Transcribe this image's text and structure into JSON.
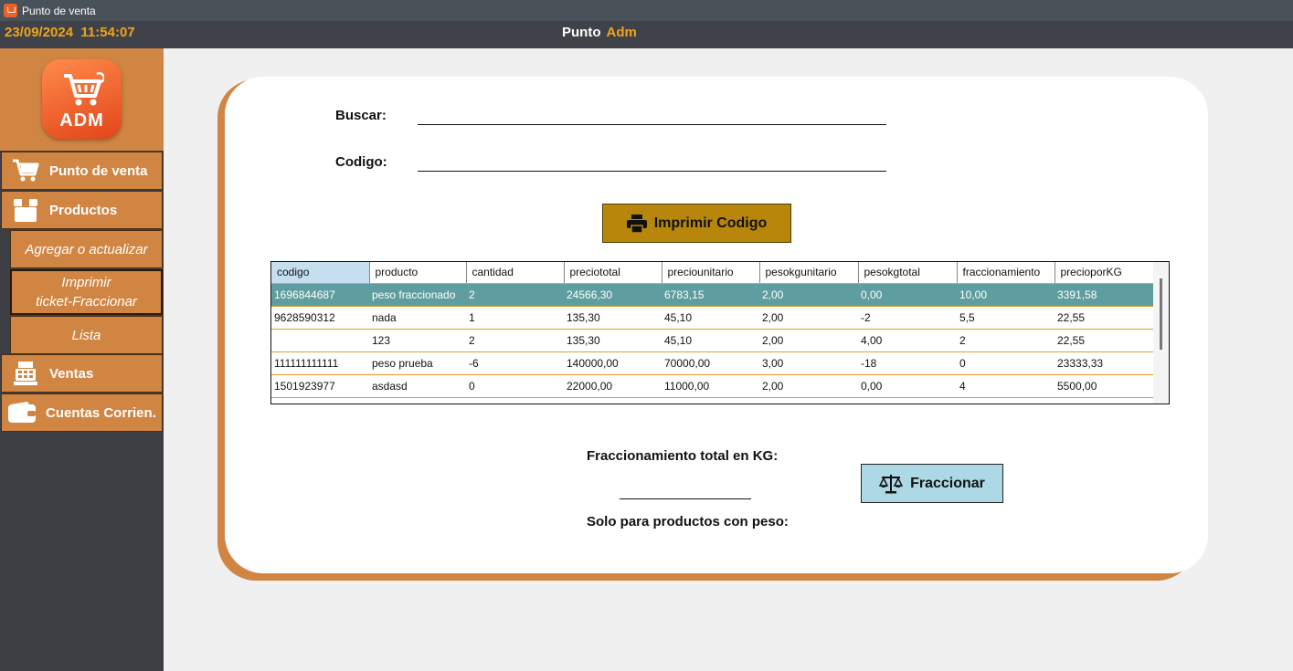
{
  "window": {
    "title": "Punto de venta"
  },
  "header": {
    "datetime": "23/09/2024  11:54:07",
    "center_1": "Punto",
    "center_2": "Adm"
  },
  "sidebar": {
    "logo_text": "ADM",
    "items": [
      {
        "label": "Punto de venta",
        "icon": "cart-icon"
      },
      {
        "label": "Productos",
        "icon": "box-icon"
      },
      {
        "label": "Ventas",
        "icon": "cash-register-icon"
      },
      {
        "label": "Cuentas Corrien.",
        "icon": "wallet-icon"
      }
    ],
    "subitems": [
      {
        "label": "Agregar o actualizar"
      },
      {
        "label": "Imprimir\nticket-Fraccionar"
      },
      {
        "label": "Lista"
      }
    ]
  },
  "form": {
    "buscar_label": "Buscar:",
    "buscar_value": "",
    "codigo_label": "Codigo:",
    "codigo_value": "",
    "print_button": "Imprimir Codigo"
  },
  "table": {
    "columns": [
      "codigo",
      "producto",
      "cantidad",
      "preciototal",
      "preciounitario",
      "pesokgunitario",
      "pesokgtotal",
      "fraccionamiento",
      "precioporKG"
    ],
    "rows": [
      [
        "1696844687",
        "peso fraccionado",
        "2",
        "24566,30",
        "6783,15",
        "2,00",
        "0,00",
        "10,00",
        "3391,58"
      ],
      [
        "9628590312",
        "nada",
        "1",
        "135,30",
        "45,10",
        "2,00",
        "-2",
        "5,5",
        "22,55"
      ],
      [
        "",
        "123",
        "2",
        "135,30",
        "45,10",
        "2,00",
        "4,00",
        "2",
        "22,55"
      ],
      [
        "111111111111",
        "peso prueba",
        "-6",
        "140000,00",
        "70000,00",
        "3,00",
        "-18",
        "0",
        "23333,33"
      ],
      [
        "1501923977",
        "asdasd",
        "0",
        "22000,00",
        "11000,00",
        "2,00",
        "0,00",
        "4",
        "5500,00"
      ]
    ]
  },
  "fraccion": {
    "total_label": "Fraccionamiento total en KG:",
    "total_value": "",
    "note": "Solo para productos con peso:",
    "button": "Fraccionar"
  }
}
